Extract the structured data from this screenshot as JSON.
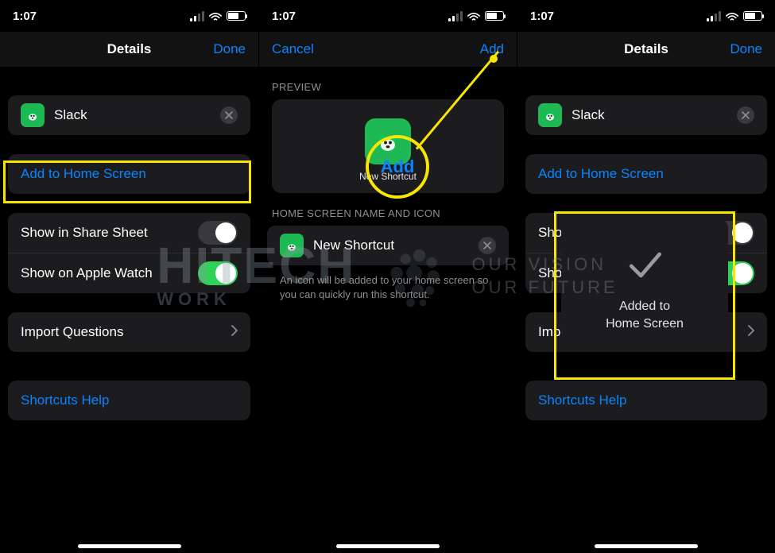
{
  "status": {
    "time": "1:07"
  },
  "accent": "#0a84ff",
  "highlight": "#f7e600",
  "switch_on_color": "#30d158",
  "scene1": {
    "nav": {
      "title": "Details",
      "right": "Done",
      "left": ""
    },
    "shortcut_name": "Slack",
    "shortcut_icon": "dog-icon",
    "add_home": "Add to Home Screen",
    "share_sheet": {
      "label": "Show in Share Sheet",
      "on": false
    },
    "apple_watch": {
      "label": "Show on Apple Watch",
      "on": true
    },
    "import_q": "Import Questions",
    "help": "Shortcuts Help"
  },
  "scene2": {
    "nav": {
      "title": "",
      "left": "Cancel",
      "right": "Add"
    },
    "preview_label": "PREVIEW",
    "preview_name": "New Shortcut",
    "section_label": "HOME SCREEN NAME AND ICON",
    "name_value": "New Shortcut",
    "help": "An icon will be added to your home screen so you can quickly run this shortcut.",
    "callout_text": "Add"
  },
  "scene3": {
    "nav": {
      "title": "Details",
      "right": "Done",
      "left": ""
    },
    "shortcut_name": "Slack",
    "shortcut_icon": "dog-icon",
    "add_home": "Add to Home Screen",
    "share_sheet_label_trunc": "Sho",
    "apple_watch_label_trunc": "Sho",
    "import_q_trunc": "Imp",
    "help": "Shortcuts Help",
    "toast": "Added to\nHome Screen"
  },
  "watermark": {
    "brand": "HITECH",
    "sub": "WORK",
    "vision": "OUR VISION",
    "future": "OUR FUTURE"
  }
}
